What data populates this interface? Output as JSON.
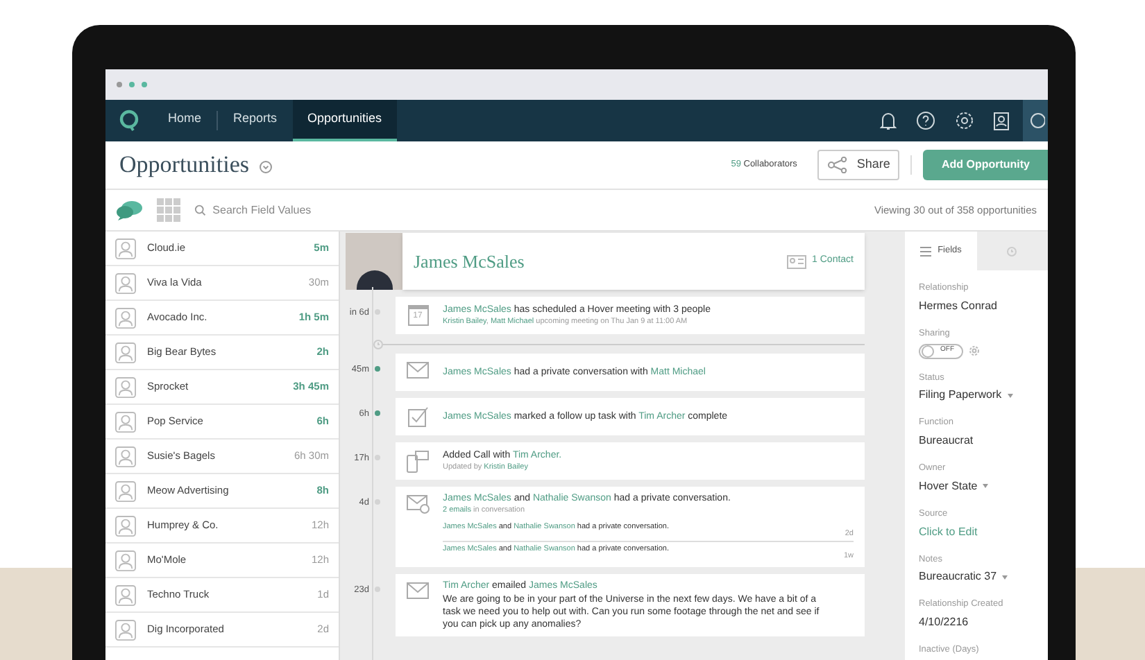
{
  "nav": {
    "items": [
      {
        "label": "Home",
        "selected": false
      },
      {
        "label": "Reports",
        "selected": false
      },
      {
        "label": "Opportunities",
        "selected": true
      }
    ]
  },
  "header": {
    "title": "Opportunities",
    "collaborators_count": "59",
    "collaborators_label": "Collaborators",
    "share": "Share",
    "add": "Add Opportunity"
  },
  "toolbar": {
    "search_placeholder": "Search Field Values",
    "viewing": "Viewing 30 out of 358 opportunities"
  },
  "list": [
    {
      "name": "Cloud.ie",
      "time": "5m",
      "highlight": true
    },
    {
      "name": "Viva la Vida",
      "time": "30m",
      "highlight": false
    },
    {
      "name": "Avocado Inc.",
      "time": "1h 5m",
      "highlight": true
    },
    {
      "name": "Big Bear Bytes",
      "time": "2h",
      "highlight": true
    },
    {
      "name": "Sprocket",
      "time": "3h 45m",
      "highlight": true
    },
    {
      "name": "Pop Service",
      "time": "6h",
      "highlight": true
    },
    {
      "name": "Susie's Bagels",
      "time": "6h 30m",
      "highlight": false
    },
    {
      "name": "Meow Advertising",
      "time": "8h",
      "highlight": true
    },
    {
      "name": "Humprey & Co.",
      "time": "12h",
      "highlight": false
    },
    {
      "name": "Mo'Mole",
      "time": "12h",
      "highlight": false
    },
    {
      "name": "Techno Truck",
      "time": "1d",
      "highlight": false
    },
    {
      "name": "Dig Incorporated",
      "time": "2d",
      "highlight": false
    }
  ],
  "contact": {
    "name": "James McSales",
    "contacts": "1 Contact"
  },
  "timeline": [
    {
      "time": "in 6d",
      "active": false,
      "kind": "calendar",
      "calendar_day": "17",
      "title": [
        {
          "text": "James McSales",
          "link": true
        },
        {
          "text": " has scheduled a Hover meeting with 3 people",
          "link": false
        }
      ],
      "subtitle": [
        {
          "text": "Kristin Bailey",
          "link": true
        },
        {
          "text": ", ",
          "link": false
        },
        {
          "text": "Matt Michael",
          "link": true
        },
        {
          "text": " upcoming meeting on Thu Jan 9 at 11:00 AM",
          "link": false
        }
      ]
    },
    {
      "time": "45m",
      "active": true,
      "kind": "mail",
      "title": [
        {
          "text": "James McSales",
          "link": true
        },
        {
          "text": " had a private conversation with ",
          "link": false
        },
        {
          "text": "Matt Michael",
          "link": true
        }
      ]
    },
    {
      "time": "6h",
      "active": true,
      "kind": "task",
      "title": [
        {
          "text": "James McSales",
          "link": true
        },
        {
          "text": " marked a follow up task with ",
          "link": false
        },
        {
          "text": "Tim Archer",
          "link": true
        },
        {
          "text": " complete",
          "link": false
        }
      ]
    },
    {
      "time": "17h",
      "active": false,
      "kind": "call",
      "title": [
        {
          "text": "Added Call with ",
          "link": false
        },
        {
          "text": "Tim Archer.",
          "link": true
        }
      ],
      "subtitle": [
        {
          "text": "Updated by ",
          "link": false
        },
        {
          "text": "Kristin Bailey",
          "link": true
        }
      ]
    },
    {
      "time": "4d",
      "active": false,
      "kind": "mail-thread",
      "title": [
        {
          "text": "James McSales",
          "link": true
        },
        {
          "text": " and ",
          "link": false
        },
        {
          "text": "Nathalie Swanson",
          "link": true
        },
        {
          "text": " had a private conversation.",
          "link": false
        }
      ],
      "subtitle": [
        {
          "text": "2 emails",
          "link": true
        },
        {
          "text": " in conversation",
          "link": false
        }
      ],
      "replies": [
        {
          "parts": [
            {
              "text": "James McSales",
              "link": true
            },
            {
              "text": " and ",
              "link": false
            },
            {
              "text": "Nathalie Swanson",
              "link": true
            },
            {
              "text": " had a private conversation.",
              "link": false
            }
          ],
          "time": "2d"
        },
        {
          "parts": [
            {
              "text": "James McSales",
              "link": true
            },
            {
              "text": " and ",
              "link": false
            },
            {
              "text": "Nathalie Swanson",
              "link": true
            },
            {
              "text": " had a private conversation.",
              "link": false
            }
          ],
          "time": "1w"
        }
      ]
    },
    {
      "time": "23d",
      "active": false,
      "kind": "mail",
      "title": [
        {
          "text": "Tim Archer",
          "link": true
        },
        {
          "text": " emailed ",
          "link": false
        },
        {
          "text": "James McSales",
          "link": true
        }
      ],
      "body": "We are going to be in your part of the Universe in the next few days. We have a bit of a task we need you to help out with. Can you run some footage through the net and see if you can pick up any anomalies?"
    }
  ],
  "panel": {
    "tabs": [
      {
        "label": "Fields",
        "selected": true
      },
      {
        "selected": false
      }
    ],
    "fields": [
      {
        "label": "Relationship",
        "kind": "text",
        "value": "Hermes Conrad"
      },
      {
        "label": "Sharing",
        "kind": "toggle",
        "value": "OFF",
        "on": false
      },
      {
        "label": "Status",
        "kind": "dropdown",
        "value": "Filing Paperwork"
      },
      {
        "label": "Function",
        "kind": "text",
        "value": "Bureaucrat"
      },
      {
        "label": "Owner",
        "kind": "dropdown",
        "value": "Hover State"
      },
      {
        "label": "Source",
        "kind": "link",
        "value": "Click to Edit"
      },
      {
        "label": "Notes",
        "kind": "dropdown",
        "value": "Bureaucratic 37"
      },
      {
        "label": "Relationship Created",
        "kind": "text",
        "value": "4/10/2216"
      },
      {
        "label": "Inactive (Days)",
        "kind": "label"
      }
    ]
  }
}
